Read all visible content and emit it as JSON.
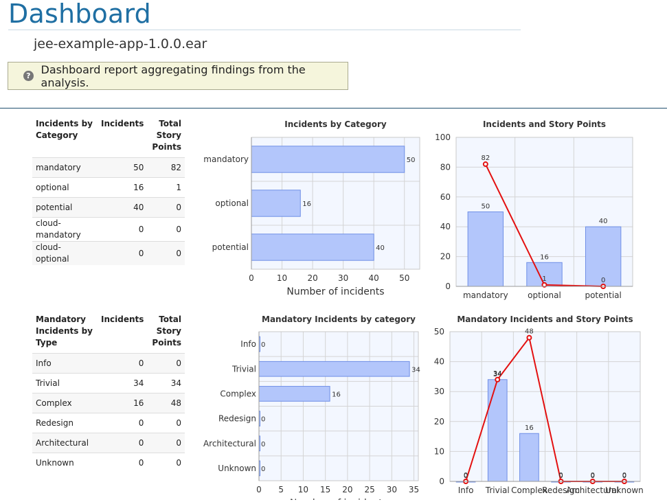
{
  "header": {
    "title": "Dashboard",
    "app_name": "jee-example-app-1.0.0.ear",
    "info_text": "Dashboard report aggregating findings from the analysis."
  },
  "category_table": {
    "columns": [
      "Incidents by Category",
      "Incidents",
      "Total Story Points"
    ],
    "rows": [
      {
        "label": "mandatory",
        "incidents": "50",
        "points": "82"
      },
      {
        "label": "optional",
        "incidents": "16",
        "points": "1"
      },
      {
        "label": "potential",
        "incidents": "40",
        "points": "0"
      },
      {
        "label": "cloud-mandatory",
        "incidents": "0",
        "points": "0"
      },
      {
        "label": "cloud-optional",
        "incidents": "0",
        "points": "0"
      }
    ]
  },
  "type_table": {
    "columns": [
      "Mandatory Incidents by Type",
      "Incidents",
      "Total Story Points"
    ],
    "rows": [
      {
        "label": "Info",
        "incidents": "0",
        "points": "0"
      },
      {
        "label": "Trivial",
        "incidents": "34",
        "points": "34"
      },
      {
        "label": "Complex",
        "incidents": "16",
        "points": "48"
      },
      {
        "label": "Redesign",
        "incidents": "0",
        "points": "0"
      },
      {
        "label": "Architectural",
        "incidents": "0",
        "points": "0"
      },
      {
        "label": "Unknown",
        "incidents": "0",
        "points": "0"
      }
    ]
  },
  "colors": {
    "accent": "#1f6fa3",
    "bar_fill": "#b3c6fb",
    "bar_stroke": "#6f8fe6",
    "line": "#e31010",
    "grid": "#d4d4d4",
    "plot_bg": "#f3f7ff"
  },
  "icons": {
    "help": "question-circle-icon",
    "help_glyph": "?"
  },
  "chart_data": [
    {
      "id": "cat_bar",
      "type": "bar",
      "orientation": "horizontal",
      "title": "Incidents by Category",
      "xlabel": "Number of incidents",
      "ylabel": "",
      "categories": [
        "mandatory",
        "optional",
        "potential"
      ],
      "values": [
        50,
        16,
        40
      ],
      "xlim": [
        0,
        55
      ],
      "ticks": [
        0,
        10,
        20,
        30,
        40,
        50
      ],
      "grid": true
    },
    {
      "id": "cat_combo",
      "type": "bar",
      "title": "Incidents and Story Points",
      "xlabel": "",
      "ylabel": "",
      "categories": [
        "mandatory",
        "optional",
        "potential"
      ],
      "series": [
        {
          "kind": "bar",
          "values": [
            50,
            16,
            40
          ]
        },
        {
          "kind": "line",
          "values": [
            82,
            1,
            0
          ]
        }
      ],
      "ylim": [
        0,
        100
      ],
      "ticks": [
        0,
        20,
        40,
        60,
        80,
        100
      ],
      "grid": true
    },
    {
      "id": "type_bar",
      "type": "bar",
      "orientation": "horizontal",
      "title": "Mandatory Incidents by category",
      "xlabel": "Number of incidents",
      "ylabel": "",
      "categories": [
        "Info",
        "Trivial",
        "Complex",
        "Redesign",
        "Architectural",
        "Unknown"
      ],
      "values": [
        0,
        34,
        16,
        0,
        0,
        0
      ],
      "xlim": [
        0,
        36
      ],
      "ticks": [
        0,
        5,
        10,
        15,
        20,
        25,
        30,
        35
      ],
      "grid": true
    },
    {
      "id": "type_combo",
      "type": "bar",
      "title": "Mandatory Incidents and Story Points",
      "xlabel": "",
      "ylabel": "",
      "categories": [
        "Info",
        "Trivial",
        "Complex",
        "Redesign",
        "Architectural",
        "Unknown"
      ],
      "series": [
        {
          "kind": "bar",
          "values": [
            0,
            34,
            16,
            0,
            0,
            0
          ]
        },
        {
          "kind": "line",
          "values": [
            0,
            34,
            48,
            0,
            0,
            0
          ]
        }
      ],
      "ylim": [
        0,
        50
      ],
      "ticks": [
        0,
        10,
        20,
        30,
        40,
        50
      ],
      "grid": true
    }
  ]
}
